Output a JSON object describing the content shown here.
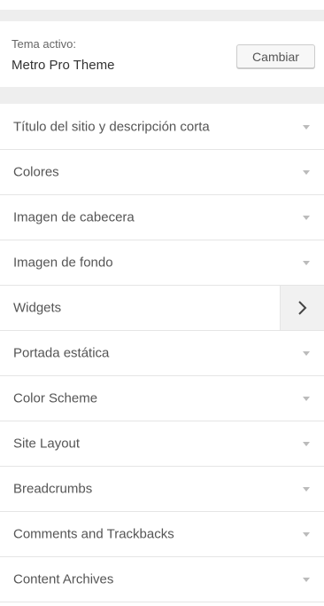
{
  "theme": {
    "label": "Tema activo:",
    "name": "Metro Pro Theme",
    "change_label": "Cambiar"
  },
  "sections": [
    {
      "label": "Título del sitio y descripción corta",
      "icon": "caret-down-icon"
    },
    {
      "label": "Colores",
      "icon": "caret-down-icon"
    },
    {
      "label": "Imagen de cabecera",
      "icon": "caret-down-icon"
    },
    {
      "label": "Imagen de fondo",
      "icon": "caret-down-icon"
    },
    {
      "label": "Widgets",
      "icon": "chevron-right-icon"
    },
    {
      "label": "Portada estática",
      "icon": "caret-down-icon"
    },
    {
      "label": "Color Scheme",
      "icon": "caret-down-icon"
    },
    {
      "label": "Site Layout",
      "icon": "caret-down-icon"
    },
    {
      "label": "Breadcrumbs",
      "icon": "caret-down-icon"
    },
    {
      "label": "Comments and Trackbacks",
      "icon": "caret-down-icon"
    },
    {
      "label": "Content Archives",
      "icon": "caret-down-icon"
    }
  ]
}
